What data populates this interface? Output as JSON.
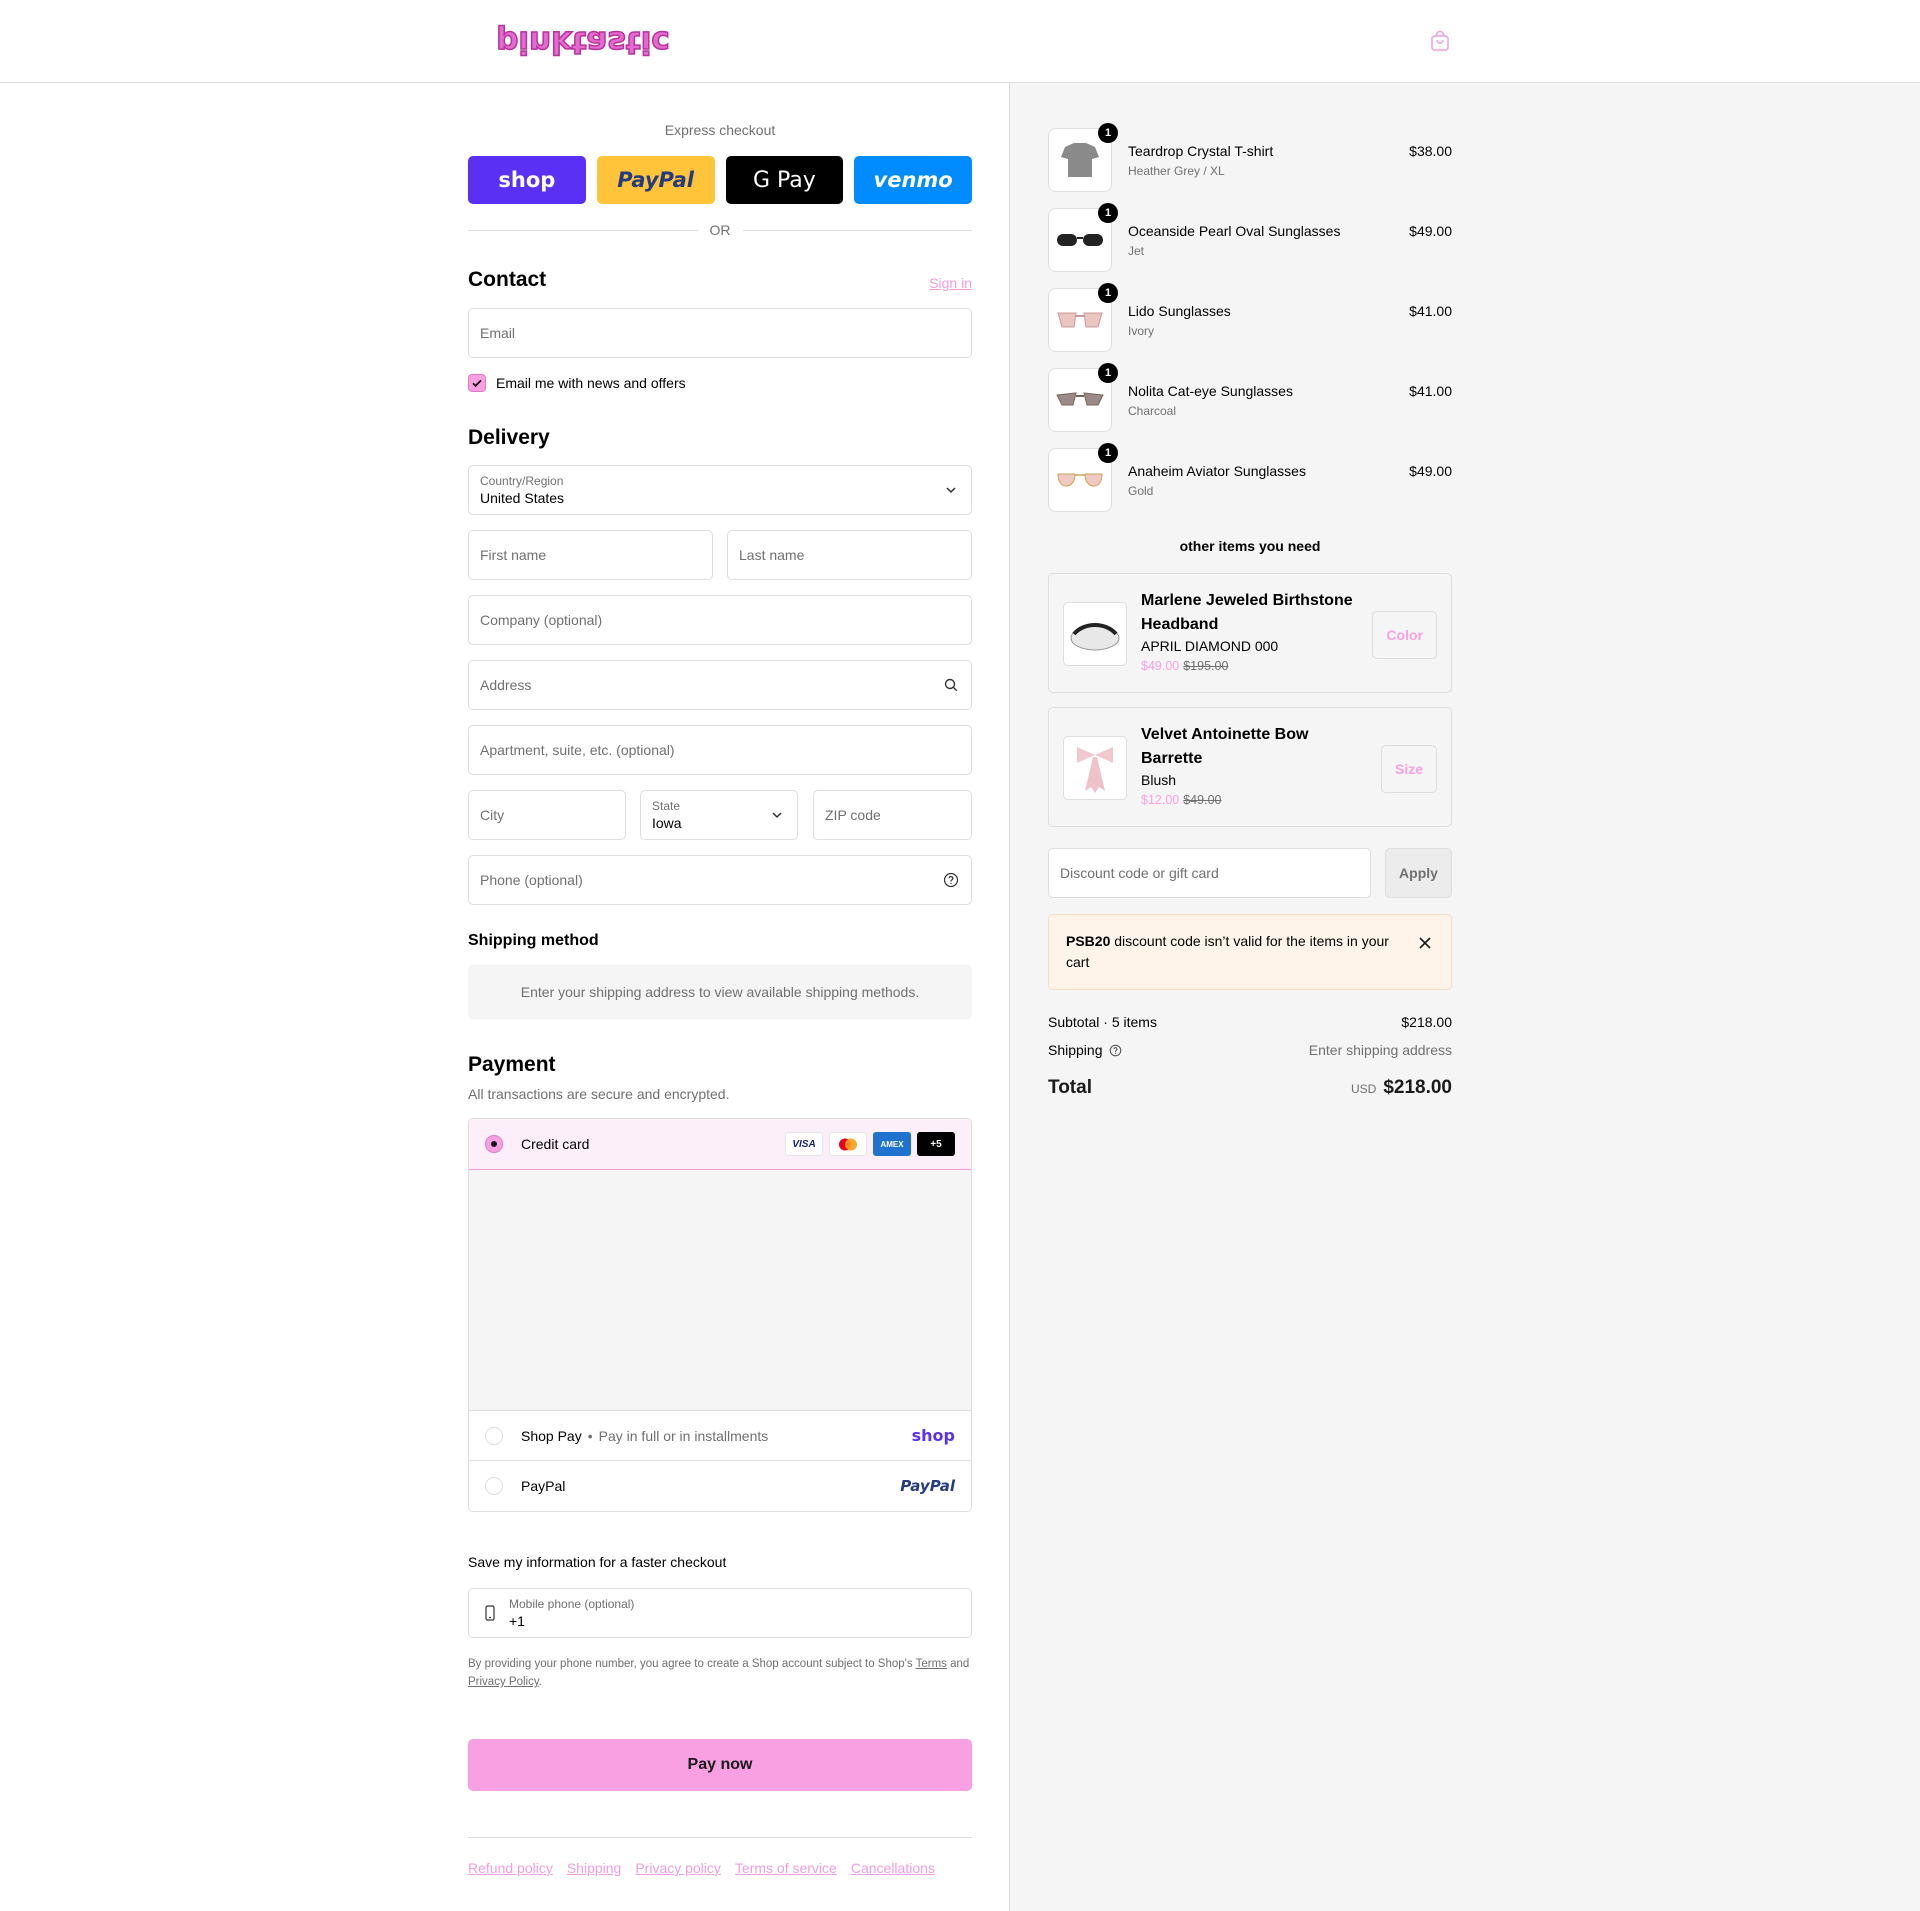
{
  "header": {
    "logo_text": "pinktastic"
  },
  "express": {
    "label": "Express checkout",
    "buttons": [
      "shop",
      "PayPal",
      "G Pay",
      "venmo"
    ],
    "or": "OR"
  },
  "contact": {
    "title": "Contact",
    "sign_in": "Sign in",
    "email_placeholder": "Email",
    "newsletter_label": "Email me with news and offers",
    "newsletter_checked": true
  },
  "delivery": {
    "title": "Delivery",
    "country_label": "Country/Region",
    "country_value": "United States",
    "first_name": "First name",
    "last_name": "Last name",
    "company": "Company (optional)",
    "address": "Address",
    "apartment": "Apartment, suite, etc. (optional)",
    "city": "City",
    "state_label": "State",
    "state_value": "Iowa",
    "zip": "ZIP code",
    "phone": "Phone (optional)"
  },
  "shipping": {
    "title": "Shipping method",
    "message": "Enter your shipping address to view available shipping methods."
  },
  "payment": {
    "title": "Payment",
    "note": "All transactions are secure and encrypted.",
    "credit_card": "Credit card",
    "card_badges": [
      "VISA",
      "MC",
      "AMEX",
      "+5"
    ],
    "shop_pay": "Shop Pay",
    "shop_pay_sub": "Pay in full or in installments",
    "shop_pay_logo": "shop",
    "paypal": "PayPal",
    "paypal_logo": "PayPal"
  },
  "save_info": {
    "title": "Save my information for a faster checkout",
    "mobile_label": "Mobile phone (optional)",
    "mobile_value": "+1",
    "legal_1": "By providing your phone number, you agree to create a Shop account subject to Shop's ",
    "terms": "Terms",
    "legal_2": " and ",
    "privacy": "Privacy Policy",
    "legal_3": "."
  },
  "pay_now": "Pay now",
  "footer_links": [
    "Refund policy",
    "Shipping",
    "Privacy policy",
    "Terms of service",
    "Cancellations"
  ],
  "cart": {
    "items": [
      {
        "name": "Teardrop Crystal T-shirt",
        "variant": "Heather Grey / XL",
        "price": "$38.00",
        "qty": "1"
      },
      {
        "name": "Oceanside Pearl Oval Sunglasses",
        "variant": "Jet",
        "price": "$49.00",
        "qty": "1"
      },
      {
        "name": "Lido Sunglasses",
        "variant": "Ivory",
        "price": "$41.00",
        "qty": "1"
      },
      {
        "name": "Nolita Cat-eye Sunglasses",
        "variant": "Charcoal",
        "price": "$41.00",
        "qty": "1"
      },
      {
        "name": "Anaheim Aviator Sunglasses",
        "variant": "Gold",
        "price": "$49.00",
        "qty": "1"
      }
    ],
    "upsell_title": "other items you need",
    "upsells": [
      {
        "name": "Marlene Jeweled Birthstone Headband",
        "variant": "APRIL DIAMOND 000",
        "sale": "$49.00",
        "orig": "$195.00",
        "button": "Color"
      },
      {
        "name": "Velvet Antoinette Bow Barrette",
        "variant": "Blush",
        "sale": "$12.00",
        "orig": "$49.00",
        "button": "Size"
      }
    ],
    "discount_placeholder": "Discount code or gift card",
    "apply": "Apply",
    "warning_code": "PSB20",
    "warning_text": " discount code isn’t valid for the items in your cart",
    "subtotal_label": "Subtotal · 5 items",
    "subtotal_value": "$218.00",
    "shipping_label": "Shipping",
    "shipping_value": "Enter shipping address",
    "total_label": "Total",
    "currency": "USD",
    "total_value": "$218.00"
  },
  "colors": {
    "accent": "#f8a0e2",
    "accent_link": "#f09de0",
    "shop_purple": "#5a31f4"
  }
}
